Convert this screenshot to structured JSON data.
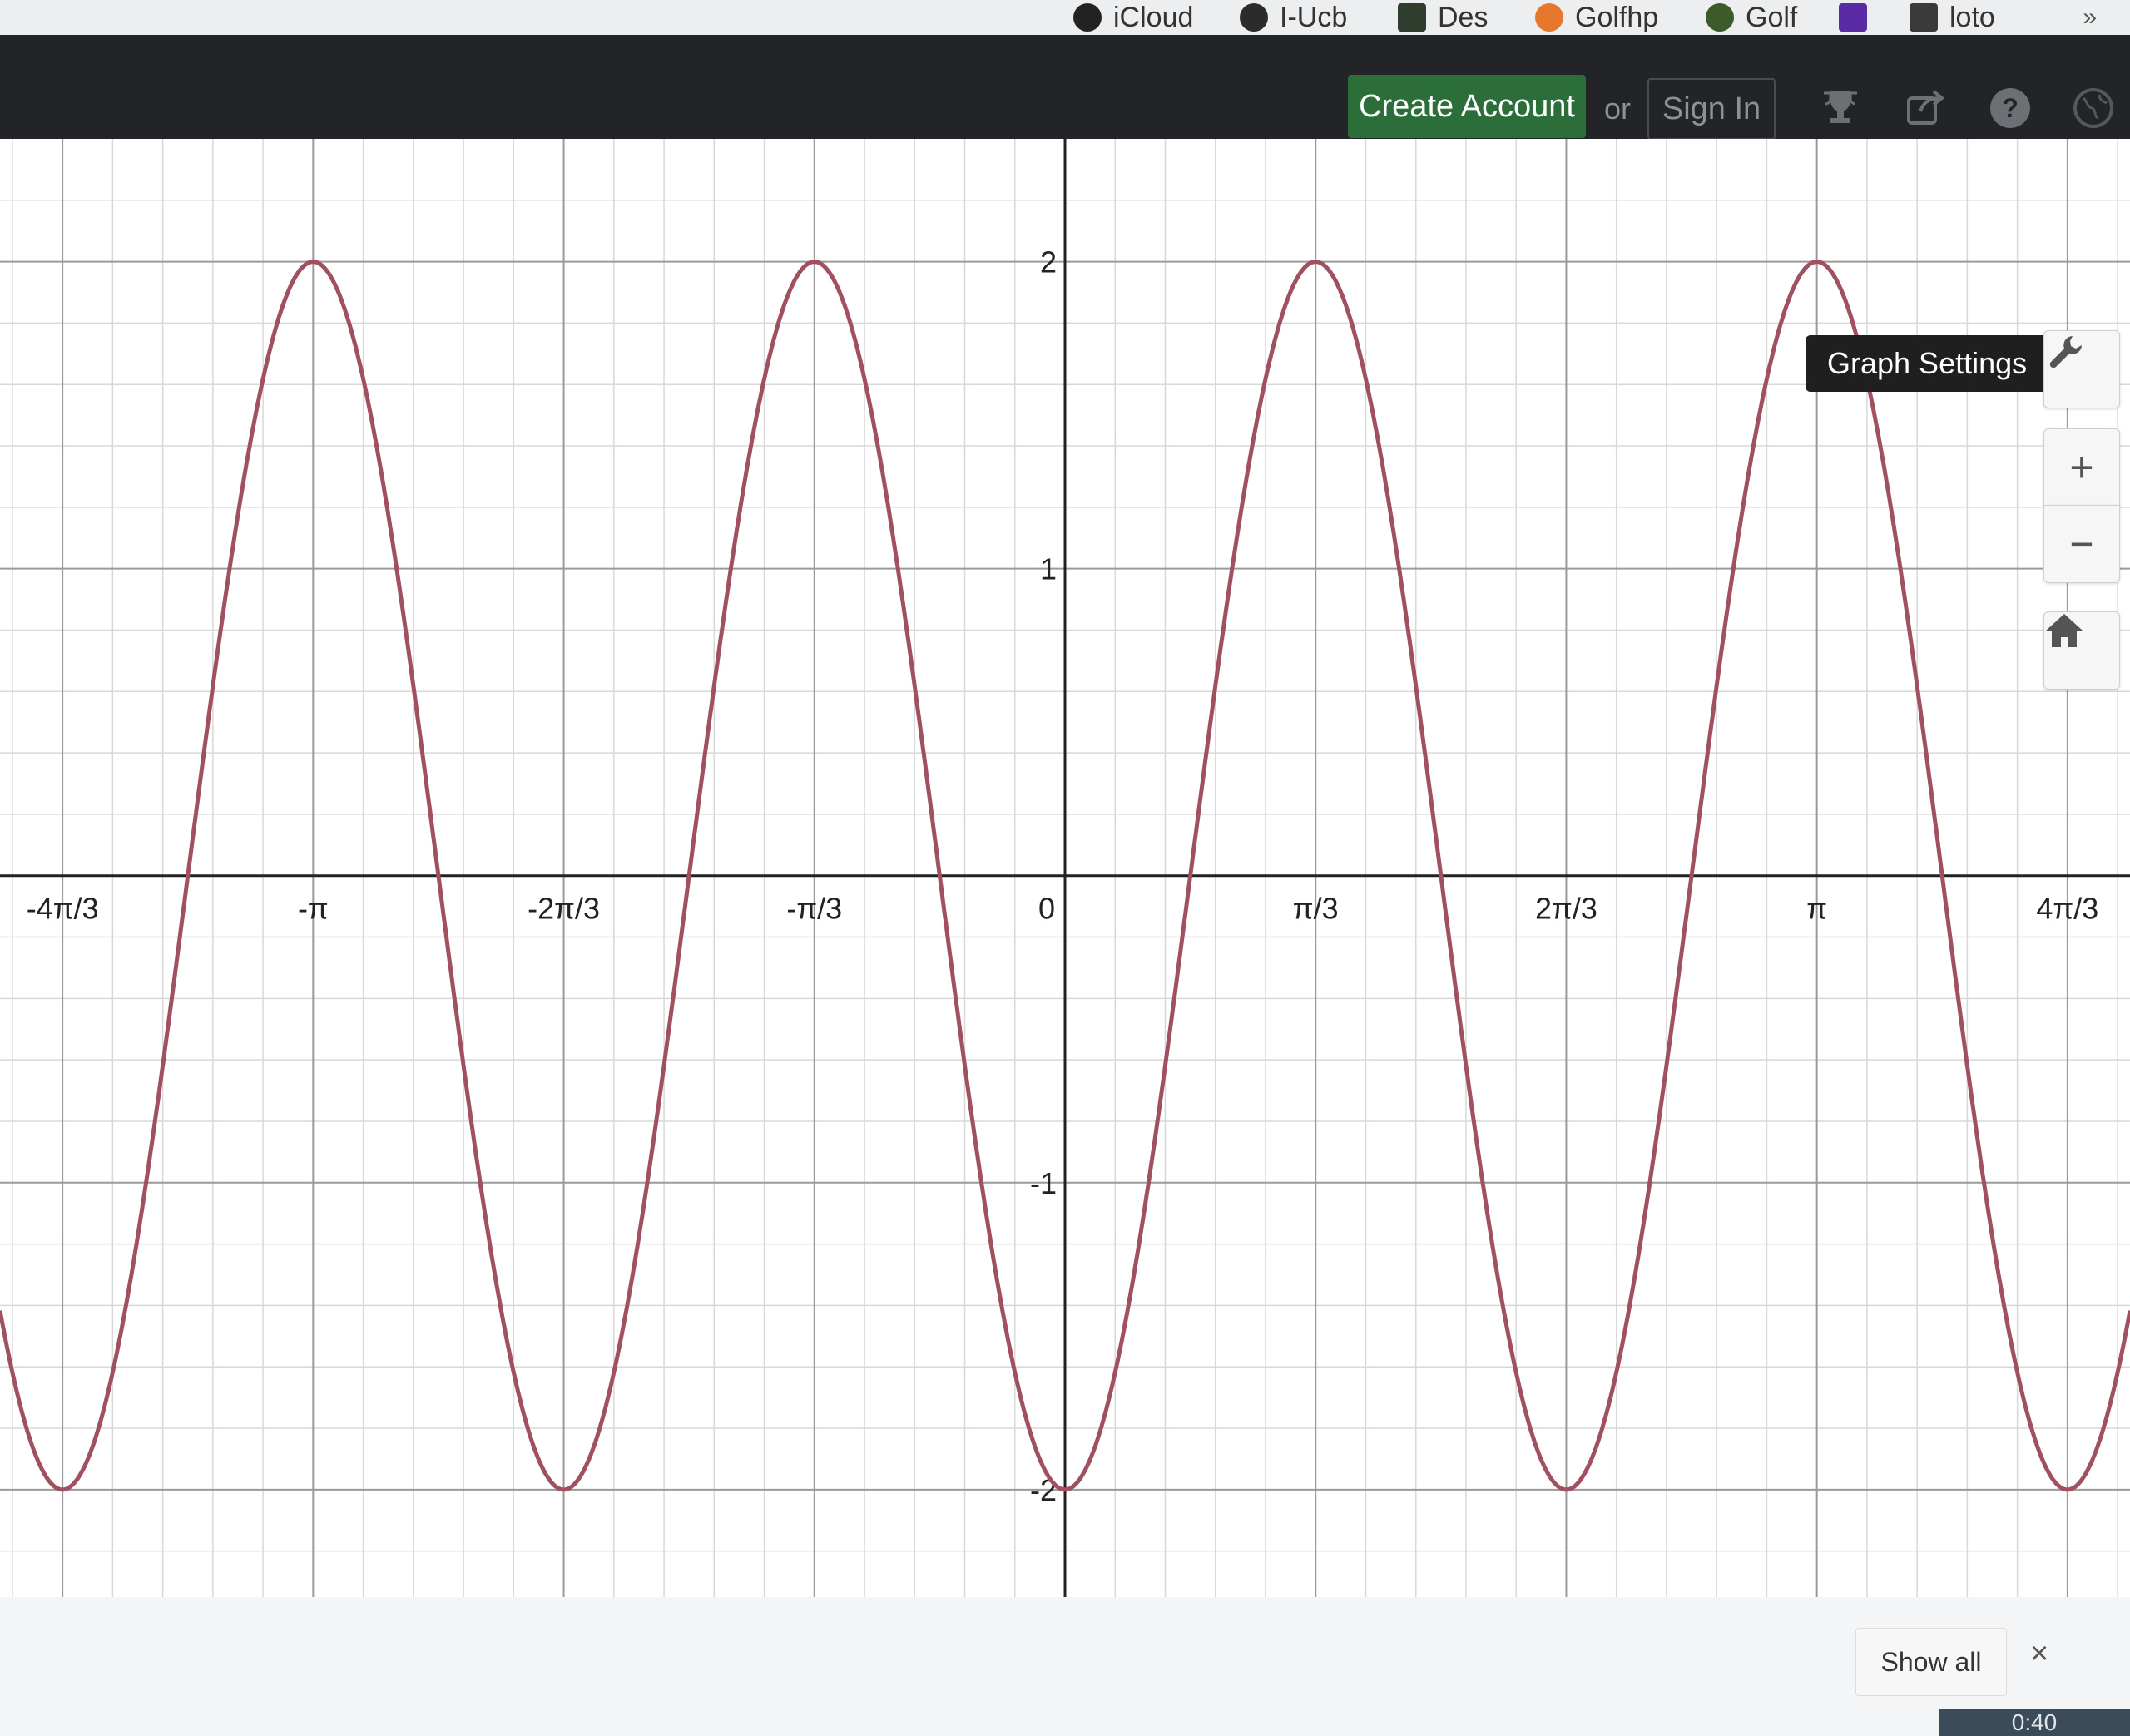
{
  "bookmarks": {
    "items": [
      {
        "label": "iCloud",
        "icon": "apple-icon"
      },
      {
        "label": "I-Ucb",
        "icon": "globe-icon"
      },
      {
        "label": "Des",
        "icon": "desmos-icon"
      },
      {
        "label": "Golfhp",
        "icon": "smiley-icon"
      },
      {
        "label": "Golf",
        "icon": "ball-icon"
      },
      {
        "label": "",
        "icon": "yahoo-icon"
      },
      {
        "label": "loto",
        "icon": "grid-icon"
      }
    ],
    "more": "»"
  },
  "header": {
    "create_account": "Create Account",
    "or": "or",
    "sign_in": "Sign In",
    "icons": [
      "trophy-icon",
      "share-icon",
      "help-icon",
      "language-icon"
    ]
  },
  "graph": {
    "tooltip": "Graph Settings",
    "zoom_in": "+",
    "zoom_out": "−",
    "show_all": "Show all",
    "close": "×",
    "time": "0:40",
    "curve_color": "#a0505e"
  },
  "chart_data": {
    "type": "line",
    "function": "y = -2cos(3x)",
    "x_tick_labels": [
      "-4π/3",
      "-π",
      "-2π/3",
      "-π/3",
      "0",
      "π/3",
      "2π/3",
      "π",
      "4π/3"
    ],
    "x_tick_values": [
      -4.18879,
      -3.14159,
      -2.0944,
      -1.0472,
      0,
      1.0472,
      2.0944,
      3.14159,
      4.18879
    ],
    "y_tick_labels": [
      "-2",
      "-1",
      "1",
      "2"
    ],
    "y_tick_values": [
      -2,
      -1,
      1,
      2
    ],
    "xlim": [
      -4.45,
      4.45
    ],
    "ylim": [
      -2.35,
      2.4
    ],
    "grid": true
  }
}
